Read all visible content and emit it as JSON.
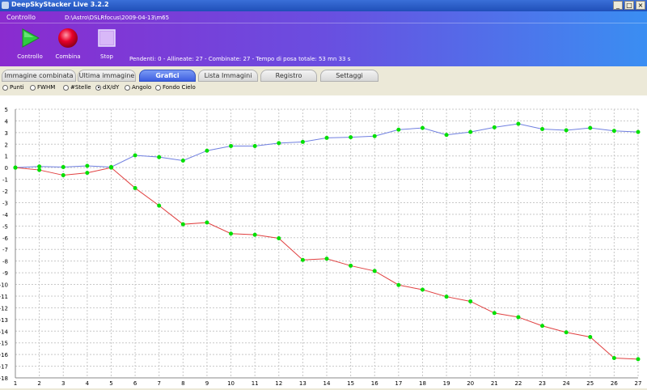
{
  "window": {
    "title": "DeepSkyStacker Live 3.2.2",
    "buttons": [
      "_",
      "□",
      "×"
    ]
  },
  "control": {
    "label": "Controllo",
    "path": "D:\\Astro\\DSLRfocus\\2009-04-13\\m65",
    "buttons": [
      {
        "label": "Controllo",
        "icon": "play-icon",
        "color": "#2ecc40"
      },
      {
        "label": "Combina",
        "icon": "record-icon",
        "color": "#e8002a"
      },
      {
        "label": "Stop",
        "icon": "stop-icon",
        "color": "#c8a0f0"
      }
    ],
    "status": "Pendenti: 0 - Allineate: 27 - Combinate: 27 - Tempo di posa totale: 53 mn 33 s"
  },
  "tabs": [
    {
      "label": "Immagine combinata",
      "active": false
    },
    {
      "label": "Ultima immagine",
      "active": false
    },
    {
      "label": "Grafici",
      "active": true
    },
    {
      "label": "Lista Immagini",
      "active": false
    },
    {
      "label": "Registro",
      "active": false
    },
    {
      "label": "Settaggi",
      "active": false
    }
  ],
  "graph_options": [
    {
      "label": "Punti",
      "selected": false
    },
    {
      "label": "FWHM",
      "selected": false
    },
    {
      "label": "#Stelle",
      "selected": false
    },
    {
      "label": "dX/dY",
      "selected": true
    },
    {
      "label": "Angolo",
      "selected": false
    },
    {
      "label": "Fondo Cielo",
      "selected": false
    }
  ],
  "chart_data": {
    "type": "line",
    "x": [
      1,
      2,
      3,
      4,
      5,
      6,
      7,
      8,
      9,
      10,
      11,
      12,
      13,
      14,
      15,
      16,
      17,
      18,
      19,
      20,
      21,
      22,
      23,
      24,
      25,
      26,
      27
    ],
    "xlim": [
      1,
      27
    ],
    "ylim": [
      -18,
      5
    ],
    "yticks": [
      5,
      4,
      3,
      2,
      1,
      0,
      -1,
      -2,
      -3,
      -4,
      -5,
      -6,
      -7,
      -8,
      -9,
      -10,
      -11,
      -12,
      -13,
      -14,
      -15,
      -16,
      -17,
      -18
    ],
    "grid": true,
    "marker_color": "#00e000",
    "series": [
      {
        "color": "#6f7fe0",
        "values": [
          0,
          0.1,
          0.05,
          0.15,
          0.05,
          1.05,
          0.9,
          0.6,
          1.45,
          1.85,
          1.85,
          2.1,
          2.2,
          2.55,
          2.6,
          2.7,
          3.25,
          3.4,
          2.8,
          3.05,
          3.45,
          3.75,
          3.3,
          3.2,
          3.4,
          3.15,
          3.05
        ]
      },
      {
        "color": "#e04040",
        "values": [
          0,
          -0.2,
          -0.65,
          -0.45,
          0,
          -1.75,
          -3.25,
          -4.85,
          -4.7,
          -5.65,
          -5.75,
          -6.05,
          -7.9,
          -7.8,
          -8.4,
          -8.85,
          -10.05,
          -10.45,
          -11.05,
          -11.45,
          -12.45,
          -12.8,
          -13.55,
          -14.1,
          -14.5,
          -16.3,
          -16.4
        ]
      }
    ]
  }
}
